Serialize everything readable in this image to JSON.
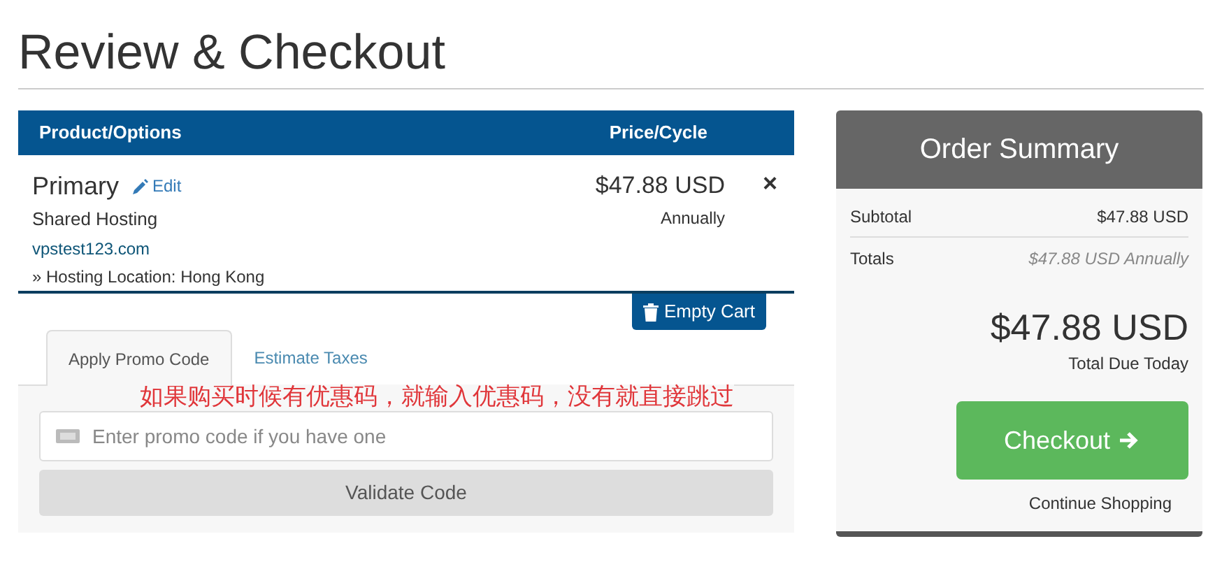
{
  "page_title": "Review & Checkout",
  "cart": {
    "columns": [
      "Product/Options",
      "Price/Cycle"
    ],
    "items": [
      {
        "name": "Primary",
        "edit_link": "Edit",
        "group": "Shared Hosting",
        "domain": "vpstest123.com",
        "option": "» Hosting Location: Hong Kong",
        "price": "$47.88 USD",
        "cycle": "Annually",
        "remove": "×"
      }
    ],
    "empty_cart_button": "Empty Cart"
  },
  "tabs": [
    {
      "label": "Apply Promo Code",
      "selected": true
    },
    {
      "label": "Estimate Taxes",
      "selected": false
    }
  ],
  "promo": {
    "placeholder": "Enter promo code if you have one",
    "button": "Validate Code"
  },
  "annotation": "如果购买时候有优惠码，就输入优惠码，没有就直接跳过",
  "order_summary": {
    "title": "Order Summary",
    "rows": [
      {
        "label": "Subtotal",
        "value": "$47.88 USD",
        "kind": "plain"
      },
      {
        "label": "Totals",
        "value": "$47.88 USD Annually",
        "kind": "recurring"
      }
    ],
    "total": "$47.88 USD",
    "total_label": "Total Due Today",
    "checkout_button": "Checkout",
    "continue_link": "Continue Shopping"
  }
}
